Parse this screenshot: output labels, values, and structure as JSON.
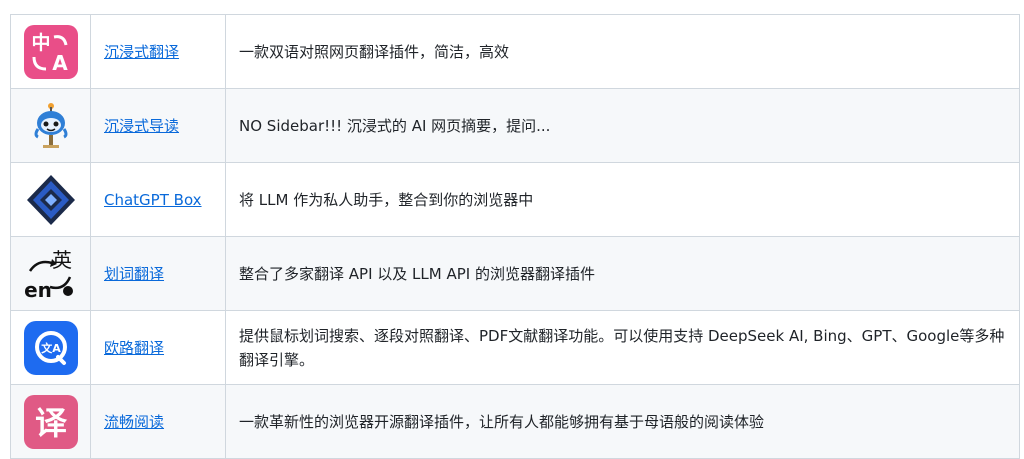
{
  "extensions": [
    {
      "icon": "immersive-translate-icon",
      "name": "沉浸式翻译",
      "description": "一款双语对照网页翻译插件，简洁，高效"
    },
    {
      "icon": "immersive-reader-icon",
      "name": "沉浸式导读",
      "description": "NO Sidebar!!! 沉浸式的 AI 网页摘要，提问..."
    },
    {
      "icon": "chatgpt-box-icon",
      "name": "ChatGPT Box",
      "description": "将 LLM 作为私人助手，整合到你的浏览器中"
    },
    {
      "icon": "word-translate-icon",
      "name": "划词翻译",
      "description": "整合了多家翻译 API 以及 LLM API 的浏览器翻译插件"
    },
    {
      "icon": "ouludict-translate-icon",
      "name": "欧路翻译",
      "description": "提供鼠标划词搜索、逐段对照翻译、PDF文献翻译功能。可以使用支持 DeepSeek AI, Bing、GPT、Google等多种翻译引擎。"
    },
    {
      "icon": "fluent-read-icon",
      "name": "流畅阅读",
      "description": "一款革新性的浏览器开源翻译插件，让所有人都能够拥有基于母语般的阅读体验"
    }
  ],
  "icon_glyphs": {
    "immersive_top": "中",
    "immersive_bottom": "A",
    "word_translate_top": "英",
    "word_translate_bottom": "en",
    "fluent_read": "译"
  },
  "colors": {
    "link": "#0969da",
    "border": "#d0d7de",
    "stripe": "#f6f8fa",
    "immersive_bg": "#e94e88",
    "chatgpt_box_blue": "#2a5bc4",
    "ouludict_blue": "#1e6bf0",
    "fluent_read_bg": "#e05a85"
  }
}
